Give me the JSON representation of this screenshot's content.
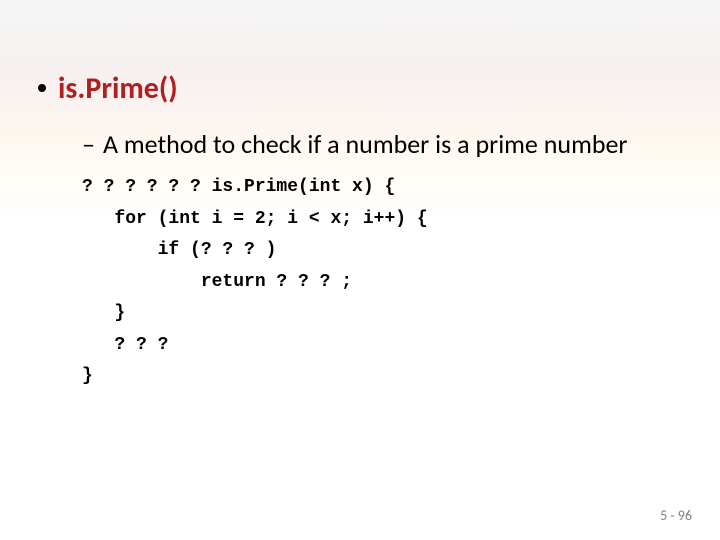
{
  "bullet": {
    "title": "is.Prime()"
  },
  "sub": {
    "dash": "–",
    "text": "A method to check if a number is a prime number"
  },
  "code": {
    "l1": "? ? ? ? ? ? is.Prime(int x) {",
    "l2": "   for (int i = 2; i < x; i++) {",
    "l3": "       if (? ? ? )",
    "l4": "           return ? ? ? ;",
    "l5": "   }",
    "l6": "   ? ? ?",
    "l7": "}"
  },
  "footer": {
    "pageref": "5 - 96"
  }
}
